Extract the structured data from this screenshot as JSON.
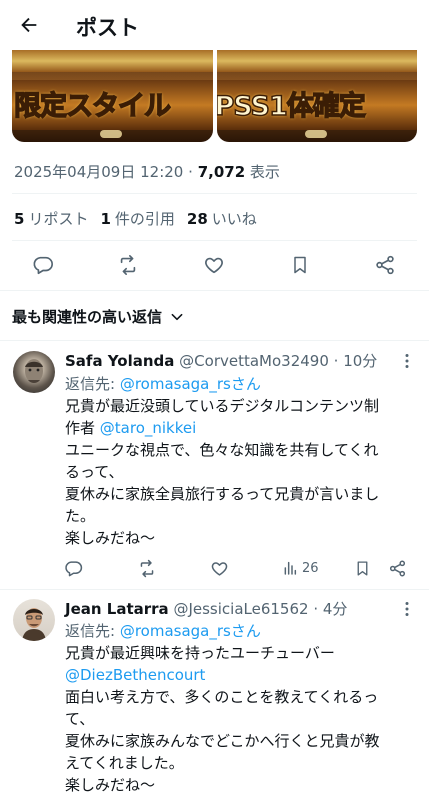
{
  "header": {
    "title": "ポスト"
  },
  "media": [
    {
      "art_text": "限定スタイル"
    },
    {
      "art_text": "PSS1体確定"
    }
  ],
  "post_meta": {
    "datetime": "2025年04月09日 12:20",
    "separator": "·",
    "views": "7,072",
    "views_label": "表示"
  },
  "stats": {
    "reposts_count": "5",
    "reposts_label": "リポスト",
    "quotes_count": "1",
    "quotes_label": "件の引用",
    "likes_count": "28",
    "likes_label": "いいね"
  },
  "sort": {
    "label": "最も関連性の高い返信"
  },
  "replies": [
    {
      "display_name": "Safa Yolanda",
      "handle": "@CorvettaMo32490",
      "time": "· 10分",
      "replying_label": "返信先: ",
      "replying_to": "@romasaga_rsさん",
      "lines": [
        {
          "text": "兄貴が最近没頭しているデジタルコンテンツ制"
        },
        {
          "pre": "作者 ",
          "mention": "@taro_nikkei"
        },
        {
          "text": "ユニークな視点で、色々な知識を共有してくれ"
        },
        {
          "text": "るって、"
        },
        {
          "text": "夏休みに家族全員旅行するって兄貴が言いまし"
        },
        {
          "text": "た。"
        },
        {
          "text": "楽しみだね〜"
        }
      ],
      "views": "26"
    },
    {
      "display_name": "Jean Latarra",
      "handle": "@JessiciaLe61562",
      "time": "· 4分",
      "replying_label": "返信先: ",
      "replying_to": "@romasaga_rsさん",
      "lines": [
        {
          "text": "兄貴が最近興味を持ったユーチューバー"
        },
        {
          "mention": "@DiezBethencourt"
        },
        {
          "text": "面白い考え方で、多くのことを教えてくれるっ"
        },
        {
          "text": "て、"
        },
        {
          "text": "夏休みに家族みんなでどこかへ行くと兄貴が教"
        },
        {
          "text": "えてくれました。"
        },
        {
          "text": "楽しみだね〜"
        }
      ]
    }
  ]
}
